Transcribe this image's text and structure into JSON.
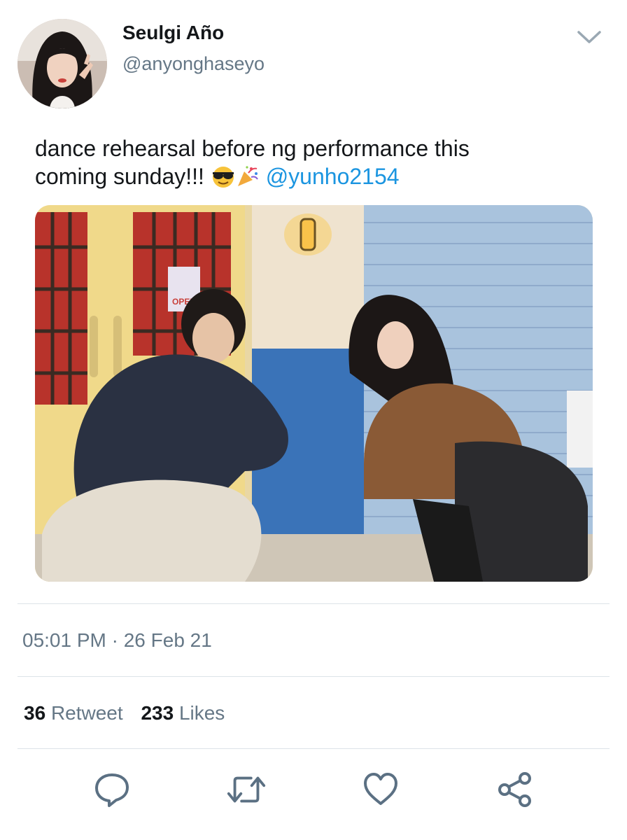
{
  "tweet": {
    "display_name": "Seulgi Año",
    "handle": "@anyonghaseyo",
    "text_line1": "dance rehearsal before ng performance this",
    "text_line2": "coming sunday!!!",
    "mention": "@yunho2154",
    "emojis": [
      "sunglasses-emoji",
      "party-popper-emoji"
    ],
    "timestamp": "05:01 PM · 26 Feb 21"
  },
  "stats": {
    "retweets_count": "36",
    "retweets_label": "Retweet",
    "likes_count": "233",
    "likes_label": "Likes"
  },
  "media": {
    "sign_text": "OPEN"
  },
  "actions": [
    "reply-icon",
    "retweet-icon",
    "like-icon",
    "share-icon"
  ],
  "colors": {
    "link": "#1b95e0",
    "secondary_text": "#657786",
    "icon": "#5b7083",
    "divider": "#dde3e8"
  }
}
